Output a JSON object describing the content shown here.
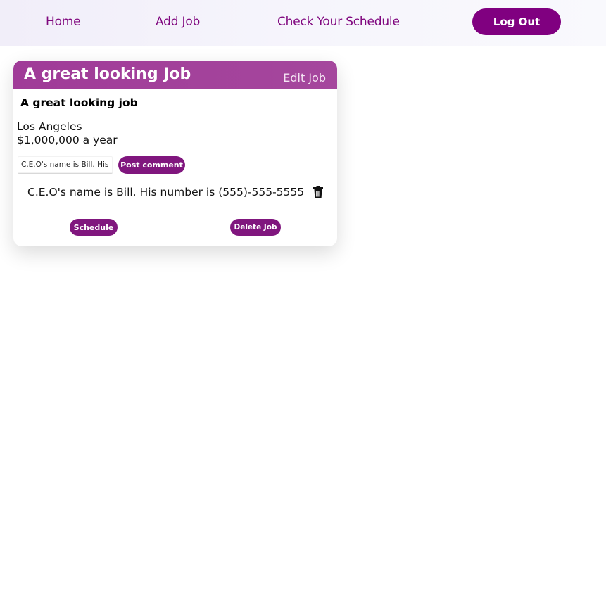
{
  "nav": {
    "home_label": "Home",
    "add_job_label": "Add Job",
    "schedule_label": "Check Your Schedule",
    "logout_label": "Log Out"
  },
  "job": {
    "title": "A great looking Job",
    "edit_label": "Edit Job",
    "subtitle": "A great looking job",
    "location": "Los Angeles",
    "salary": "$1,000,000 a year",
    "comment_input_value": "C.E.O's name is Bill. His",
    "post_comment_label": "Post comment",
    "comments": [
      {
        "text": "C.E.O's name is Bill. His number is (555)-555-5555",
        "icon": "trash-icon"
      }
    ],
    "schedule_label": "Schedule",
    "delete_label": "Delete Job"
  },
  "colors": {
    "brand": "#800080",
    "header_gradient_start": "#a03b98",
    "header_gradient_end": "#a5479d"
  }
}
